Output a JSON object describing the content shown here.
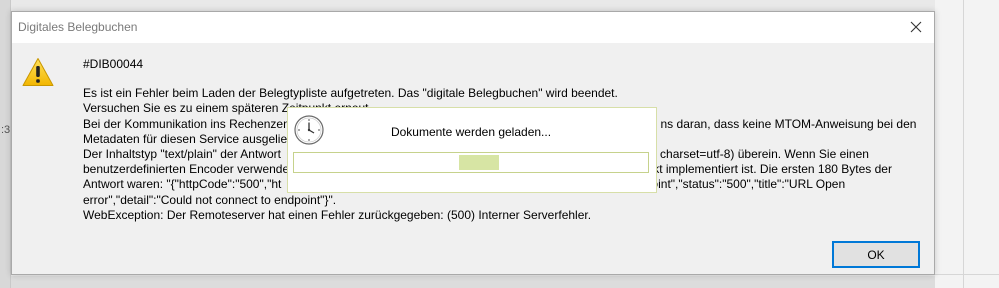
{
  "dialog": {
    "title": "Digitales Belegbuchen",
    "icon": "warning-icon",
    "close_icon": "close-icon",
    "message_lines": [
      "#DIB00044",
      "",
      "Es ist ein Fehler beim Laden der Belegtypliste aufgetreten. Das \"digitale Belegbuchen\" wird beendet.",
      "Versuchen Sie es zu einem späteren Zeitpunkt erneut.",
      "Bei der Kommunikation ins Rechenzentrum                                                                                                        ns daran, dass keine MTOM-Anweisung bei den",
      "Metadaten für diesen Service ausgelief",
      "Der Inhaltstyp \"text/plain\" der Antwort                                                                                                    ap+xml; charset=utf-8) überein. Wenn Sie einen",
      "benutzerdefinierten Encoder verwende                                                                                                     korrekt implementiert ist. Die ersten 180 Bytes der",
      "Antwort waren: \"{\"httpCode\":\"500\",\"ht                                                                                                    o endpoint\",\"status\":\"500\",\"title\":\"URL Open",
      "error\",\"detail\":\"Could not connect to endpoint\"}\".",
      "WebException: Der Remoteserver hat einen Fehler zurückgegeben: (500) Interner Serverfehler."
    ],
    "ok_label": "OK"
  },
  "loading": {
    "icon": "clock-icon",
    "text": "Dokumente werden geladen...",
    "progress_style": "marquee"
  },
  "background": {
    "edge_char": ":3"
  },
  "colors": {
    "accent": "#0078d7",
    "warning": "#f5c400",
    "progress_fill": "#d7e5a4",
    "progress_border": "#c6d28c"
  }
}
